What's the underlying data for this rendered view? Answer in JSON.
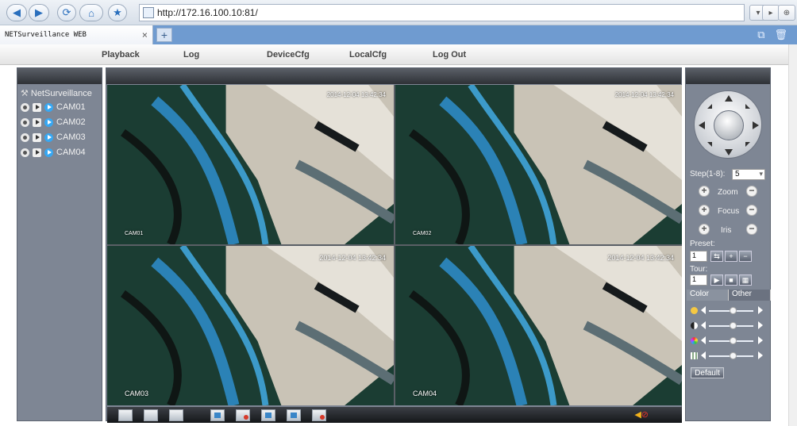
{
  "browser": {
    "back_icon": "back-arrow-icon",
    "forward_icon": "forward-arrow-icon",
    "url": "http://172.16.100.10:81/",
    "tab_title": "NETSurveillance WEB",
    "tab_close": "×",
    "new_tab": "+"
  },
  "menu": {
    "items": [
      "Playback",
      "Log",
      "DeviceCfg",
      "LocalCfg",
      "Log Out"
    ]
  },
  "tree": {
    "root": "NetSurveillance",
    "cameras": [
      "CAM01",
      "CAM02",
      "CAM03",
      "CAM04"
    ]
  },
  "video": {
    "cells": [
      {
        "timestamp": "2014-12-04 13:42:34",
        "label": "CAM01"
      },
      {
        "timestamp": "2014-12-04 13:42:34",
        "label": "CAM02"
      },
      {
        "timestamp": "2014-12-04 13:42:34",
        "label": "CAM03"
      },
      {
        "timestamp": "2014-12-04 13:42:34",
        "label": "CAM04"
      }
    ]
  },
  "ptz": {
    "step_label": "Step(1-8):",
    "step_value": "5",
    "zoom": "Zoom",
    "focus": "Focus",
    "iris": "Iris",
    "preset_label": "Preset:",
    "preset_value": "1",
    "tour_label": "Tour:",
    "tour_value": "1"
  },
  "color": {
    "tab_color": "Color",
    "tab_other": "Other",
    "default_button": "Default",
    "sliders": [
      {
        "name": "brightness",
        "level": 0.55
      },
      {
        "name": "contrast",
        "level": 0.55
      },
      {
        "name": "saturation",
        "level": 0.55
      },
      {
        "name": "hue",
        "level": 0.55
      }
    ]
  }
}
